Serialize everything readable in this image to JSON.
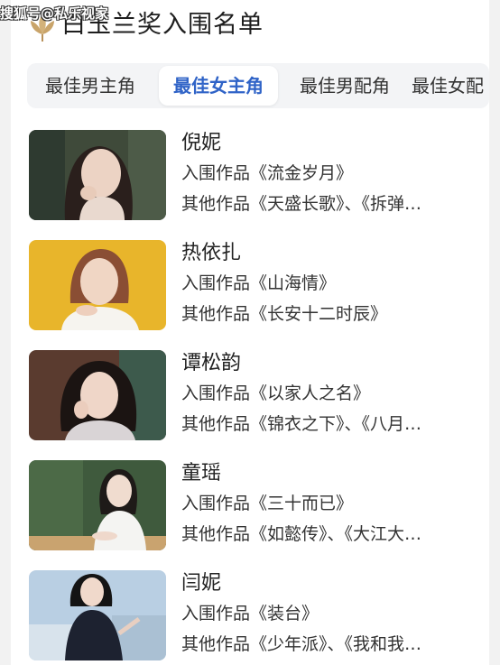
{
  "header": {
    "title": "白玉兰奖入围名单",
    "watermark": "搜狐号@私乐视家"
  },
  "tabs": [
    {
      "label": "最佳男主角",
      "active": false
    },
    {
      "label": "最佳女主角",
      "active": true
    },
    {
      "label": "最佳男配角",
      "active": false
    },
    {
      "label": "最佳女配",
      "active": false
    }
  ],
  "nominees": [
    {
      "name": "倪妮",
      "nominated_work": "入围作品《流金岁月》",
      "other_works": "其他作品《天盛长歌》、《拆弹…",
      "photo_bg": "#3f4a3a",
      "photo_accent": "#e9d9cf"
    },
    {
      "name": "热依扎",
      "nominated_work": "入围作品《山海情》",
      "other_works": "其他作品《长安十二时辰》",
      "photo_bg": "#e8b52b",
      "photo_accent": "#f6f4ef"
    },
    {
      "name": "谭松韵",
      "nominated_work": "入围作品《以家人之名》",
      "other_works": "其他作品《锦衣之下》、《八月…",
      "photo_bg": "#5a3b2f",
      "photo_accent": "#d9d4d6"
    },
    {
      "name": "童瑶",
      "nominated_work": "入围作品《三十而已》",
      "other_works": "其他作品《如懿传》、《大江大…",
      "photo_bg": "#3f5a3d",
      "photo_accent": "#f4f4f2"
    },
    {
      "name": "闫妮",
      "nominated_work": "入围作品《装台》",
      "other_works": "其他作品《少年派》、《我和我…",
      "photo_bg": "#b9cfe3",
      "photo_accent": "#1d2230"
    }
  ]
}
